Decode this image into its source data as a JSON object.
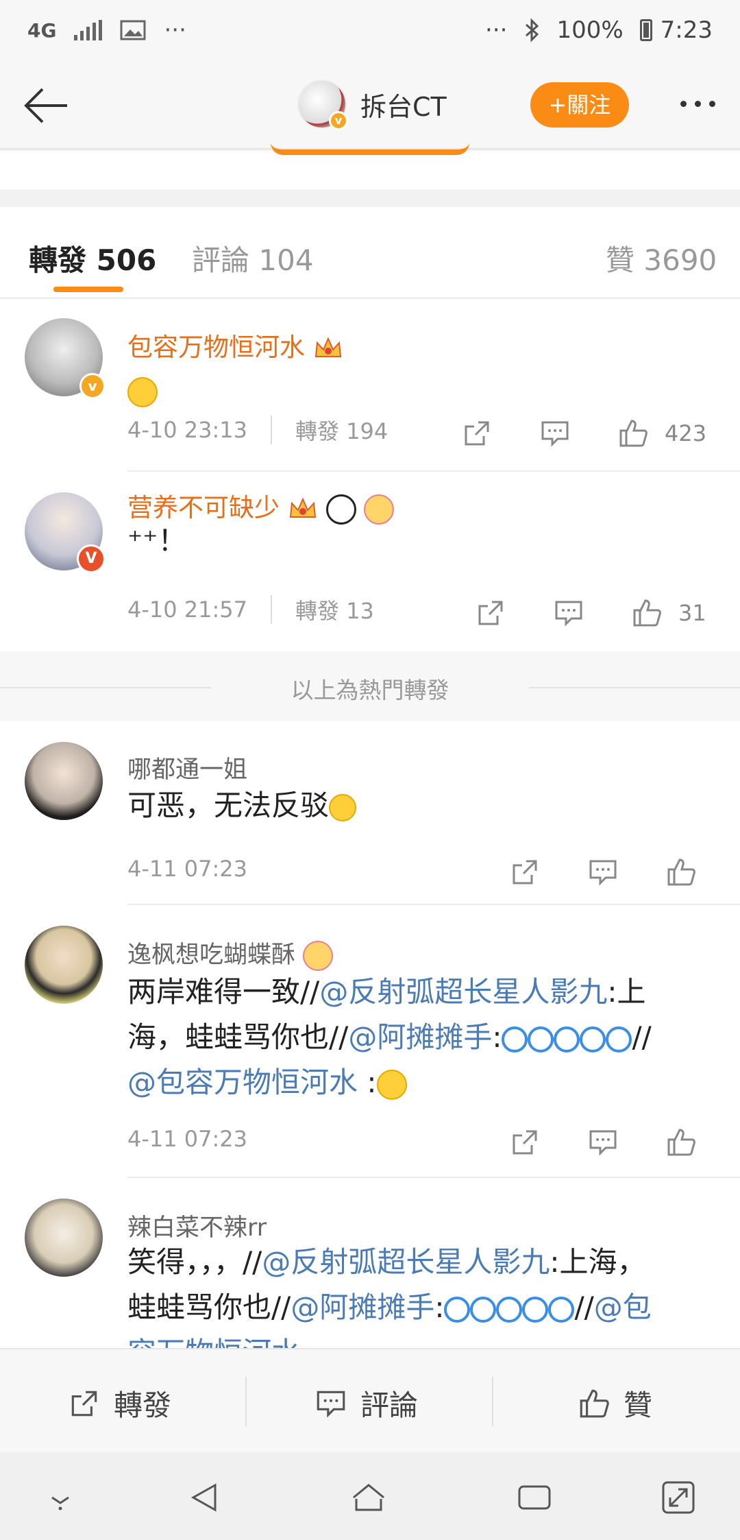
{
  "status_bar": {
    "network": "4G",
    "more": "···",
    "more_right": "···",
    "battery": "100%",
    "time": "7:23"
  },
  "header": {
    "title": "拆台CT",
    "follow_label": "+關注"
  },
  "tabs": {
    "repost": "轉發",
    "repost_count": "506",
    "comment": "評論",
    "comment_count": "104",
    "like": "贊",
    "like_count": "3690"
  },
  "hot_reposts": [
    {
      "name": "包容万物恒河水",
      "time": "4-10 23:13",
      "reposts": "轉發 194",
      "likes": "423"
    },
    {
      "name": "营养不可缺少",
      "text": "⁺⁺！",
      "time": "4-10 21:57",
      "reposts": "轉發 13",
      "likes": "31"
    }
  ],
  "hot_divider": "以上為熱門轉發",
  "latest_reposts": [
    {
      "name": "哪都通一姐",
      "text": "可恶，无法反驳",
      "time": "4-11 07:23"
    },
    {
      "name": "逸枫想吃蝴蝶酥",
      "t1": "两岸难得一致//",
      "l1": "@反射弧超长星人影九",
      "t2": ":上",
      "t3": "海，蛙蛙骂你也//",
      "l2": "@阿摊摊手",
      "t4": ":",
      "t5": "//",
      "l3": "@包容万物恒河水",
      "t6": " :",
      "time": "4-11 07:23"
    },
    {
      "name": "辣白菜不辣rr",
      "t1": "笑得，，，//",
      "l1": "@反射弧超长星人影九",
      "t2": ":上海，",
      "t3": "蛙蛙骂你也//",
      "l2": "@阿摊摊手",
      "t4": ":",
      "t5": "//",
      "l3": "@包",
      "t6": "容万物恒河水"
    }
  ],
  "bottom_bar": {
    "repost": "轉發",
    "comment": "評論",
    "like": "贊"
  },
  "colors": {
    "accent": "#fa8c16",
    "link": "#4a7bb5",
    "username_vip": "#e86f1a"
  }
}
